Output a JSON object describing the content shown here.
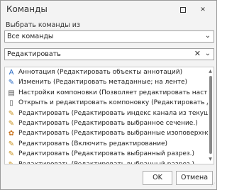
{
  "window": {
    "title": "Команды",
    "maximize_icon": "maximize-icon",
    "close_glyph": "✕"
  },
  "select_label": "Выбрать команды из",
  "source_combo": {
    "value": "Все команды",
    "arrow": "⌄"
  },
  "filter_combo": {
    "value": "Редактировать",
    "clear": "✕",
    "arrow": "⌄"
  },
  "commands": [
    {
      "icon": "annotation-icon",
      "glyph": "A",
      "color": "#2b6cc4",
      "label": "Аннотация (Редактировать объекты аннотаций)"
    },
    {
      "icon": "pencil-icon",
      "glyph": "✎",
      "color": "#2b6cc4",
      "label": "Изменить (Редактировать метаданные; на ленте)"
    },
    {
      "icon": "layout-settings-icon",
      "glyph": "▤",
      "color": "#555555",
      "label": "Настройки компоновки (Позволяет редактировать настр..."
    },
    {
      "icon": "open-layout-icon",
      "glyph": "▯",
      "color": "#555555",
      "label": "Открыть и редактировать компоновку (Редактировать до..."
    },
    {
      "icon": "edit-pencil-icon",
      "glyph": "✎",
      "color": "#c8901a",
      "label": "Редактировать (Редактировать индекс канала из текущей..."
    },
    {
      "icon": "edit-pencil-icon",
      "glyph": "✎",
      "color": "#c8901a",
      "label": "Редактировать (Редактировать выбранное сечение.)"
    },
    {
      "icon": "isosurface-edit-icon",
      "glyph": "✿",
      "color": "#c8701a",
      "label": "Редактировать (Редактировать выбранные изоповерхнос..."
    },
    {
      "icon": "edit-pencil-icon",
      "glyph": "✎",
      "color": "#c8901a",
      "label": "Редактировать (Включить редактирование)"
    },
    {
      "icon": "edit-pencil-icon",
      "glyph": "✎",
      "color": "#c8901a",
      "label": "Редактировать (Редактировать выбранный разрез.)"
    },
    {
      "icon": "edit-pencil-icon",
      "glyph": "✎",
      "color": "#c8901a",
      "label": "Редактировать (Редактировать выбранный разрез.)"
    }
  ],
  "buttons": {
    "ok": "OK",
    "cancel": "Отмена"
  }
}
